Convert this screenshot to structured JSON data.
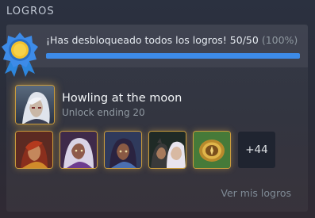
{
  "section": {
    "title": "LOGROS"
  },
  "progress": {
    "message": "¡Has desbloqueado todos los logros! 50/50",
    "percent_label": "(100%)",
    "fraction": 1.0
  },
  "featured": {
    "name": "Howling at the moon",
    "description": "Unlock ending 20",
    "icon": "white-haired-character-portrait-icon"
  },
  "achievement_icons": [
    {
      "name": "red-haired-warrior-portrait-icon"
    },
    {
      "name": "silver-haired-elf-portrait-icon"
    },
    {
      "name": "dark-haired-character-portrait-icon"
    },
    {
      "name": "two-characters-portrait-icon"
    },
    {
      "name": "golden-compass-icon"
    }
  ],
  "more_count": "+44",
  "view_all_label": "Ver mis logros",
  "colors": {
    "accent_blue": "#3d8be8",
    "gold_glow": "#c99b3c",
    "badge_yellow": "#f2c12e"
  }
}
